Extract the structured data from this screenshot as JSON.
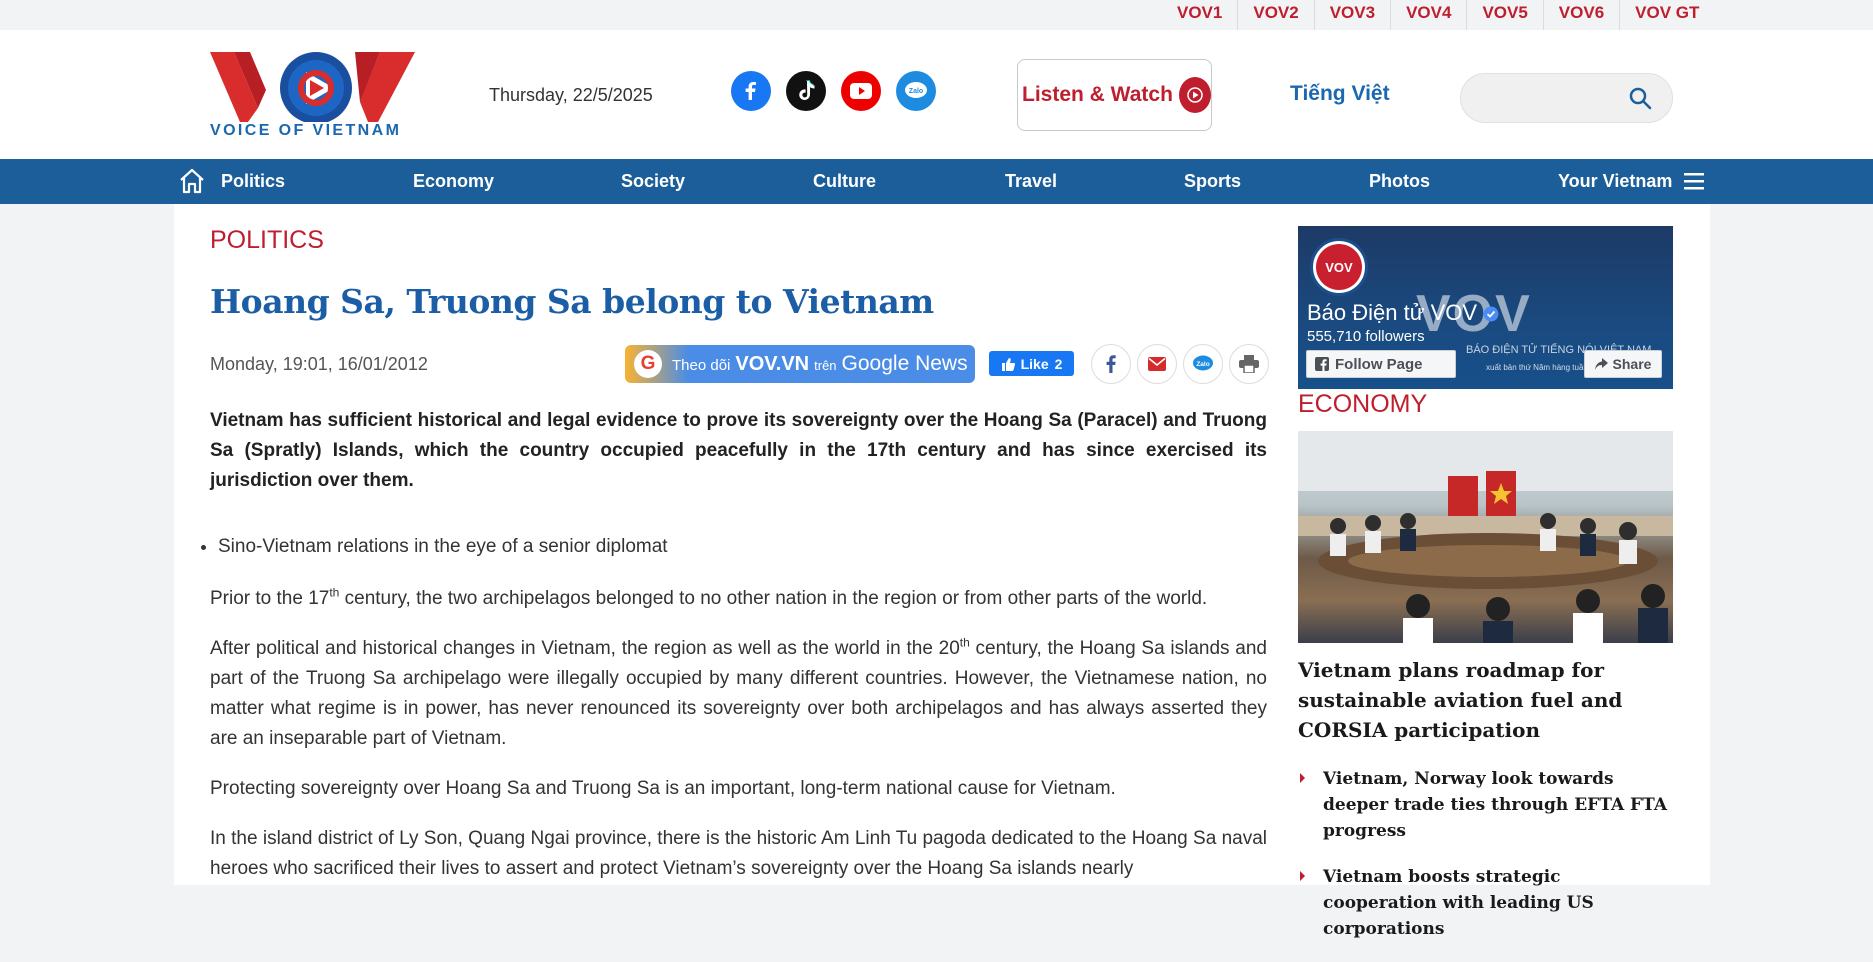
{
  "channels": [
    "VOV1",
    "VOV2",
    "VOV3",
    "VOV4",
    "VOV5",
    "VOV6",
    "VOV GT"
  ],
  "header": {
    "logo_text": "VOICE OF VIETNAM",
    "date": "Thursday, 22/5/2025",
    "listen_label": "Listen & Watch",
    "language": "Tiếng Việt",
    "search_placeholder": "",
    "socials": [
      "facebook-icon",
      "tiktok-icon",
      "youtube-icon",
      "zalo-icon"
    ]
  },
  "nav": {
    "items": [
      "Politics",
      "Economy",
      "Society",
      "Culture",
      "Travel",
      "Sports",
      "Photos",
      "Your Vietnam"
    ]
  },
  "article": {
    "category": "POLITICS",
    "title": "Hoang Sa, Truong Sa belong to Vietnam",
    "published": "Monday, 19:01, 16/01/2012",
    "gnews": {
      "t1": "Theo dõi",
      "t2": "VOV.VN",
      "t3": "trên",
      "t4": "Google News"
    },
    "like_label": "Like",
    "like_count": "2",
    "sapo": "Vietnam has sufficient historical and legal evidence to prove its sovereignty over the Hoang Sa (Paracel) and Truong Sa (Spratly) Islands, which the country occupied peacefully in the 17th century and has since exercised its jurisdiction over them.",
    "related": [
      "Sino-Vietnam relations in the eye of a senior diplomat"
    ],
    "p1_before": "Prior to the 17",
    "p1_sup": "th",
    "p1_after": " century, the two archipelagos belonged to no other nation in the region or from other parts of the world.",
    "p2_before": "After political and historical changes in Vietnam, the region as well as the world in the 20",
    "p2_sup": "th",
    "p2_after": " century, the Hoang Sa islands and part of the Truong Sa archipelago were illegally occupied by many different countries. However, the Vietnamese nation, no matter what regime is in power, has never renounced its sovereignty over both archipelagos and has always asserted they are an inseparable part of Vietnam.",
    "p3": "Protecting sovereignty over Hoang Sa and Truong Sa is an important, long-term national cause for Vietnam.",
    "p4": "In the island district of Ly Son, Quang Ngai province, there is the historic Am Linh Tu pagoda dedicated to the Hoang Sa naval heroes who sacrificed their lives to assert and protect Vietnam’s sovereignty over the Hoang Sa islands nearly"
  },
  "sidebar": {
    "fb": {
      "avatar_text": "VOV",
      "name": "Báo Điện tử VOV",
      "followers": "555,710 followers",
      "follow_label": "Follow Page",
      "share_label": "Share",
      "watermark": "VOV",
      "sub1": "BÁO ĐIỆN TỬ TIẾNG NÓI VIỆT NAM",
      "sub2": "xuất bản thứ Năm hàng tuần"
    },
    "category": "ECONOMY",
    "lead_title": "Vietnam plans roadmap for sustainable aviation fuel and CORSIA participation",
    "list": [
      "Vietnam, Norway look towards deeper trade ties through EFTA FTA progress",
      "Vietnam boosts strategic cooperation with leading US corporations"
    ]
  },
  "colors": {
    "brand_red": "#be1e2d",
    "brand_blue": "#1b5e99"
  }
}
